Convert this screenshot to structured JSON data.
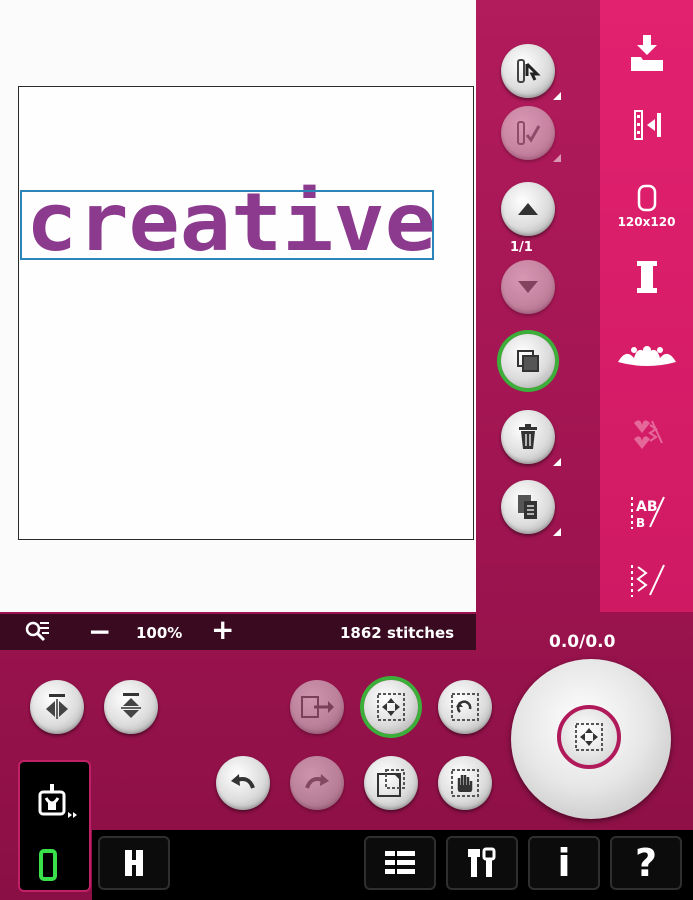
{
  "canvas": {
    "design_text": "creative",
    "design_color": "#8b3a8e",
    "selection_color": "#2a86b9"
  },
  "zoombar": {
    "zoom_value": "100%",
    "minus_label": "−",
    "plus_label": "+",
    "stitch_count": "1862 stitches"
  },
  "pager": {
    "label": "1/1"
  },
  "coordinates": {
    "label": "0.0/0.0"
  },
  "rightbar": {
    "hoop_label": "120x120",
    "items": [
      {
        "icon": "load-design-icon"
      },
      {
        "icon": "stitch-out-icon"
      },
      {
        "icon": "hoop-icon"
      },
      {
        "icon": "thread-spool-icon"
      },
      {
        "icon": "embroidery-menu-icon"
      },
      {
        "icon": "font-menu-icon"
      },
      {
        "icon": "text-edit-icon"
      },
      {
        "icon": "stitch-program-icon"
      }
    ]
  },
  "bottombar": {
    "items": [
      "mode-icon",
      "menu-icon",
      "settings-icon",
      "info-label",
      "help-label"
    ],
    "info_label": "i",
    "help_label": "?"
  },
  "colors": {
    "accent": "#d11a65",
    "active_ring": "#3cae3a",
    "background": "#a0134f"
  }
}
